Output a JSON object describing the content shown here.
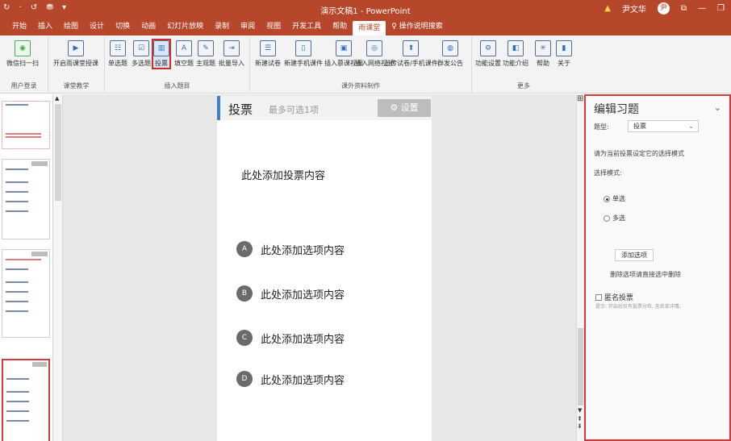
{
  "window": {
    "title": "演示文稿1 - PowerPoint",
    "quick_access": "↻ · ↺ ⛃ ▾",
    "user_name": "尹文华",
    "warning_icon": "warning-icon",
    "avatar_initial": "尹",
    "controls": [
      "⧉",
      "—",
      "❐"
    ]
  },
  "menu": {
    "tabs": [
      "开始",
      "插入",
      "绘图",
      "设计",
      "切换",
      "动画",
      "幻灯片放映",
      "录制",
      "审阅",
      "视图",
      "开发工具",
      "帮助",
      "雨课堂",
      "♀ 操作说明搜索"
    ],
    "active": "雨课堂"
  },
  "ribbon": {
    "groups": [
      {
        "label": "用户登录",
        "buttons": [
          "微信扫一扫"
        ]
      },
      {
        "label": "课堂教学",
        "buttons": [
          "开启雨课堂授课"
        ]
      },
      {
        "label": "插入题目",
        "buttons": [
          "单选题",
          "多选题",
          "投票",
          "填空题",
          "主观题",
          "批量导入"
        ]
      },
      {
        "label": "课外资料制作",
        "buttons": [
          "新建试卷",
          "新建手机课件",
          "插入慕课视频",
          "插入网络视频",
          "上传试卷/手机课件",
          "群发公告"
        ]
      },
      {
        "label": "更多",
        "buttons": [
          "功能设置",
          "功能介绍",
          "帮助",
          "关于"
        ]
      }
    ],
    "highlighted": "投票"
  },
  "slide": {
    "type_label": "投票",
    "subtitle": "最多可选1项",
    "settings_label": "⚙ 设置",
    "prompt": "此处添加投票内容",
    "options": [
      {
        "letter": "A",
        "text": "此处添加选项内容"
      },
      {
        "letter": "B",
        "text": "此处添加选项内容"
      },
      {
        "letter": "C",
        "text": "此处添加选项内容"
      },
      {
        "letter": "D",
        "text": "此处添加选项内容"
      }
    ]
  },
  "panel": {
    "title": "编辑习题",
    "type_label": "题型:",
    "type_value": "投票",
    "hint": "请为当前投票设定它的选择模式",
    "mode_label": "选择模式:",
    "modes": [
      "单选",
      "多选"
    ],
    "mode_selected": "单选",
    "add_button": "添加选项",
    "delete_hint": "删除选项请直接选中删除",
    "anonymous_label": "匿名投票",
    "anonymous_tip": "提示: 开启后仅有投票分布, 无名单详情。"
  },
  "colors": {
    "accent": "#b7472a",
    "highlight": "#d63a3a",
    "slide_bar": "#3f7fcf"
  }
}
